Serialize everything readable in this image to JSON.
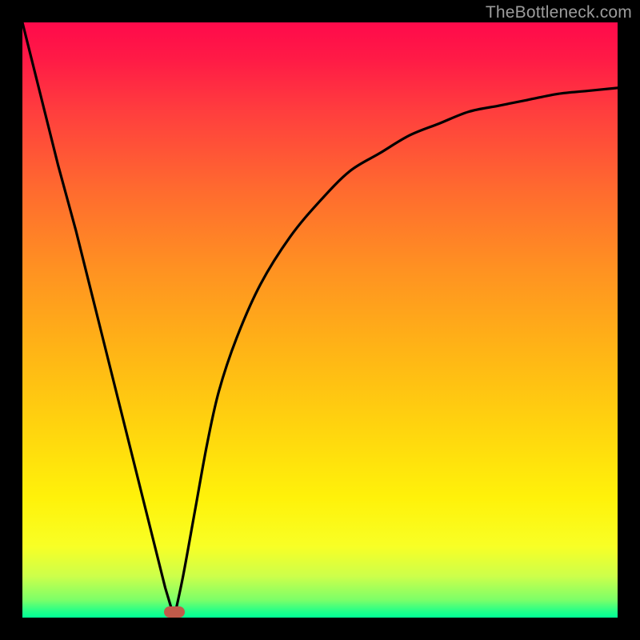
{
  "watermark": "TheBottleneck.com",
  "marker": {
    "x_pct": 25.5,
    "y_pct": 99.0
  },
  "chart_data": {
    "type": "line",
    "title": "",
    "xlabel": "",
    "ylabel": "",
    "xlim": [
      0,
      100
    ],
    "ylim": [
      0,
      100
    ],
    "grid": false,
    "legend": false,
    "annotations": [],
    "series": [
      {
        "name": "bottleneck-curve",
        "x": [
          0,
          3,
          6,
          9,
          12,
          15,
          18,
          21,
          24,
          25.5,
          27,
          29,
          31,
          33,
          36,
          40,
          45,
          50,
          55,
          60,
          65,
          70,
          75,
          80,
          85,
          90,
          95,
          100
        ],
        "values": [
          100,
          88,
          76,
          65,
          53,
          41,
          29,
          17,
          5,
          0,
          7,
          18,
          29,
          38,
          47,
          56,
          64,
          70,
          75,
          78,
          81,
          83,
          85,
          86,
          87,
          88,
          88.5,
          89
        ]
      }
    ],
    "gradient_stops": [
      {
        "pct": 0,
        "color": "#ff0a4b"
      },
      {
        "pct": 6,
        "color": "#ff1a46"
      },
      {
        "pct": 15,
        "color": "#ff3e3e"
      },
      {
        "pct": 28,
        "color": "#ff6a2f"
      },
      {
        "pct": 42,
        "color": "#ff9321"
      },
      {
        "pct": 55,
        "color": "#ffb416"
      },
      {
        "pct": 68,
        "color": "#ffd40e"
      },
      {
        "pct": 80,
        "color": "#fff20a"
      },
      {
        "pct": 88,
        "color": "#f8ff25"
      },
      {
        "pct": 93,
        "color": "#cdff4a"
      },
      {
        "pct": 97,
        "color": "#7dff68"
      },
      {
        "pct": 99,
        "color": "#20ff8a"
      },
      {
        "pct": 100,
        "color": "#00ff95"
      }
    ]
  }
}
